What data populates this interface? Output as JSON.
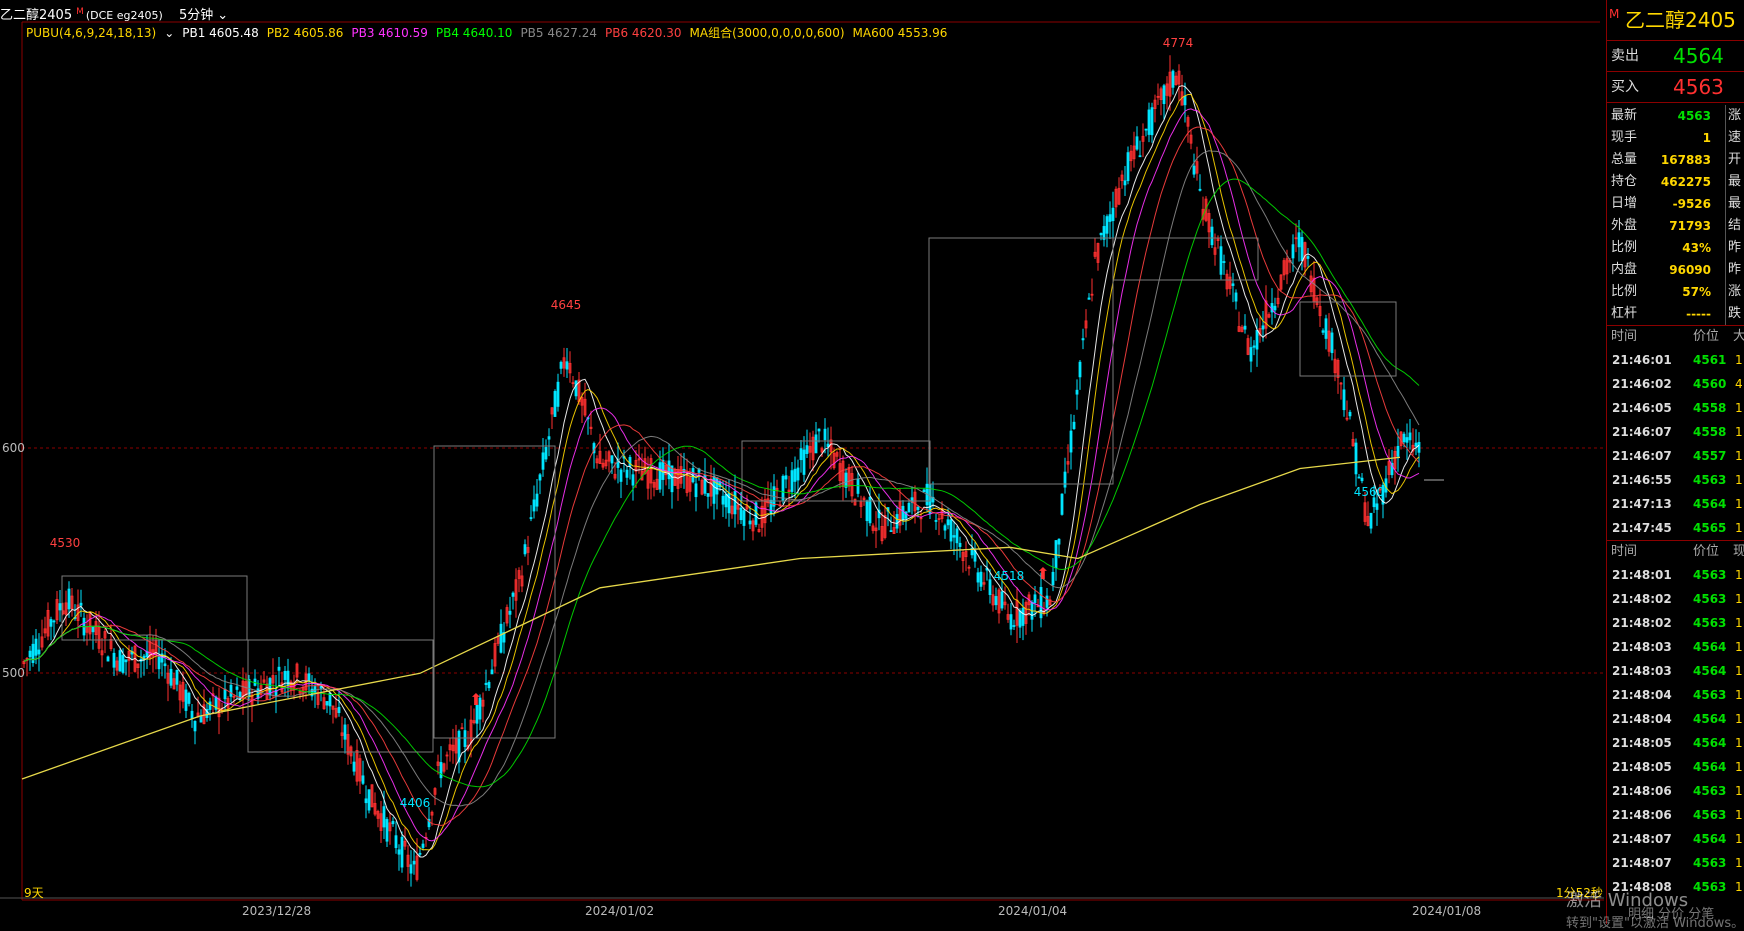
{
  "header": {
    "symbol": "乙二醇2405",
    "superscript": "M",
    "code": "(DCE eg2405)",
    "period": "5分钟",
    "period_caret": "⌄"
  },
  "indicators": [
    {
      "label": "PUBU(4,6,9,24,18,13)",
      "color": "#ffd700"
    },
    {
      "label": "⌄",
      "color": "#ffffff"
    },
    {
      "label": "PB1 4605.48",
      "color": "#ffffff"
    },
    {
      "label": "PB2 4605.86",
      "color": "#ffd700"
    },
    {
      "label": "PB3 4610.59",
      "color": "#ff33ff"
    },
    {
      "label": "PB4 4640.10",
      "color": "#00ff00"
    },
    {
      "label": "PB5 4627.24",
      "color": "#888888"
    },
    {
      "label": "PB6 4620.30",
      "color": "#ff4040"
    },
    {
      "label": "MA组合(3000,0,0,0,0,600)",
      "color": "#ffd700"
    },
    {
      "label": "MA600 4553.96",
      "color": "#ffd700"
    }
  ],
  "price_axis": {
    "upper": "600",
    "lower": "500"
  },
  "dates": [
    "2023/12/28",
    "2024/01/02",
    "2024/01/04",
    "2024/01/08"
  ],
  "footer_left": "9天",
  "footer_right": "1分52秒",
  "extremes": [
    {
      "text": "4530",
      "color": "#ff4040"
    },
    {
      "text": "4406",
      "color": "#00e5ff"
    },
    {
      "text": "4645",
      "color": "#ff4040"
    },
    {
      "text": "4518",
      "color": "#00e5ff"
    },
    {
      "text": "4774",
      "color": "#ff4040"
    },
    {
      "text": "4560",
      "color": "#00e5ff"
    }
  ],
  "arrow_glyph": "⬆",
  "colors": {
    "up": "#ff3030",
    "down": "#00e5ff",
    "ma600": "#e6d84a",
    "grid": "#8b0000"
  },
  "panel": {
    "title": "乙二醇2405",
    "title_mark": "M",
    "sell_label": "卖出",
    "sell_value": "4564",
    "buy_label": "买入",
    "buy_value": "4563",
    "stats": [
      {
        "label": "最新",
        "value": "4563",
        "right": "涨"
      },
      {
        "label": "现手",
        "value": "1",
        "right": "速"
      },
      {
        "label": "总量",
        "value": "167883",
        "right": "开"
      },
      {
        "label": "持仓",
        "value": "462275",
        "right": "最"
      },
      {
        "label": "日增",
        "value": "-9526",
        "right": "最"
      },
      {
        "label": "外盘",
        "value": "71793",
        "right": "结"
      },
      {
        "label": "比例",
        "value": "43%",
        "right": "昨"
      },
      {
        "label": "内盘",
        "value": "96090",
        "right": "昨"
      },
      {
        "label": "比例",
        "value": "57%",
        "right": "涨"
      },
      {
        "label": "杠杆",
        "value": "-----",
        "right": "跌"
      }
    ],
    "tick_header1": {
      "time": "时间",
      "price": "价位",
      "size": "大"
    },
    "ticks1": [
      {
        "time": "21:46:01",
        "price": "4561",
        "size": "1"
      },
      {
        "time": "21:46:02",
        "price": "4560",
        "size": "4"
      },
      {
        "time": "21:46:05",
        "price": "4558",
        "size": "1"
      },
      {
        "time": "21:46:07",
        "price": "4558",
        "size": "1"
      },
      {
        "time": "21:46:07",
        "price": "4557",
        "size": "1"
      },
      {
        "time": "21:46:55",
        "price": "4563",
        "size": "1"
      },
      {
        "time": "21:47:13",
        "price": "4564",
        "size": "1"
      },
      {
        "time": "21:47:45",
        "price": "4565",
        "size": "1"
      }
    ],
    "tick_header2": {
      "time": "时间",
      "price": "价位",
      "size": "现"
    },
    "ticks2": [
      {
        "time": "21:48:01",
        "price": "4563",
        "size": "1"
      },
      {
        "time": "21:48:02",
        "price": "4563",
        "size": "1"
      },
      {
        "time": "21:48:02",
        "price": "4563",
        "size": "1"
      },
      {
        "time": "21:48:03",
        "price": "4564",
        "size": "1"
      },
      {
        "time": "21:48:03",
        "price": "4564",
        "size": "1"
      },
      {
        "time": "21:48:04",
        "price": "4563",
        "size": "1"
      },
      {
        "time": "21:48:04",
        "price": "4564",
        "size": "1"
      },
      {
        "time": "21:48:05",
        "price": "4564",
        "size": "1"
      },
      {
        "time": "21:48:05",
        "price": "4564",
        "size": "1"
      },
      {
        "time": "21:48:06",
        "price": "4563",
        "size": "1"
      },
      {
        "time": "21:48:06",
        "price": "4563",
        "size": "1"
      },
      {
        "time": "21:48:07",
        "price": "4564",
        "size": "1"
      },
      {
        "time": "21:48:07",
        "price": "4563",
        "size": "1"
      },
      {
        "time": "21:48:08",
        "price": "4563",
        "size": "1"
      }
    ]
  },
  "watermark": {
    "line1": "激活 Windows",
    "line2": "转到\"设置\"以激活 Windows。",
    "bottom_tabs": "明细  分价  分笔"
  }
}
